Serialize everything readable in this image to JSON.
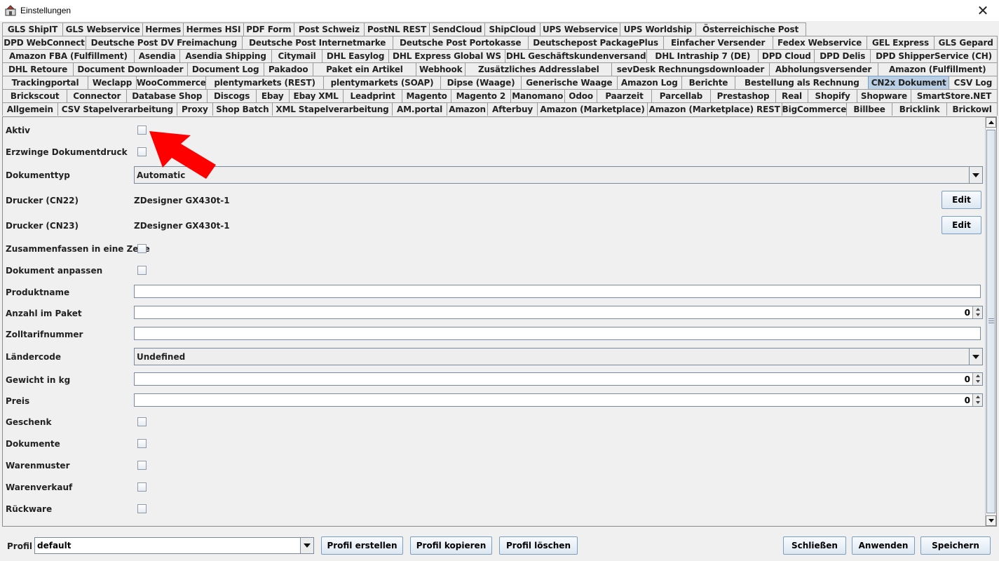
{
  "window": {
    "title": "Einstellungen",
    "close_glyph": "✕"
  },
  "tabs": {
    "rows": [
      [
        "GLS ShipIT",
        "GLS Webservice",
        "Hermes",
        "Hermes HSI",
        "PDF Form",
        "Post Schweiz",
        "PostNL REST",
        "SendCloud",
        "ShipCloud",
        "UPS Webservice",
        "UPS Worldship",
        "Österreichische Post"
      ],
      [
        "DPD WebConnect",
        "Deutsche Post DV Freimachung",
        "Deutsche Post Internetmarke",
        "Deutsche Post Portokasse",
        "Deutschepost PackagePlus",
        "Einfacher Versender",
        "Fedex Webservice",
        "GEL Express",
        "GLS Gepard"
      ],
      [
        "Amazon FBA (Fulfillment)",
        "Asendia",
        "Asendia Shipping",
        "Citymail",
        "DHL Easylog",
        "DHL Express Global WS",
        "DHL Geschäftskundenversand",
        "DHL Intraship 7 (DE)",
        "DPD Cloud",
        "DPD Delis",
        "DPD ShipperService (CH)"
      ],
      [
        "DHL Retoure",
        "Document Downloader",
        "Document Log",
        "Pakadoo",
        "Paket ein Artikel",
        "Webhook",
        "Zusätzliches Addresslabel",
        "sevDesk Rechnungsdownloader",
        "Abholungsversender",
        "Amazon (Fulfillment)"
      ],
      [
        "Trackingportal",
        "Weclapp",
        "WooCommerce",
        "plentymarkets (REST)",
        "plentymarkets (SOAP)",
        "Dipse (Waage)",
        "Generische Waage",
        "Amazon Log",
        "Berichte",
        "Bestellung als Rechnung",
        "CN2x Dokument",
        "CSV Log"
      ],
      [
        "Brickscout",
        "Connector",
        "Database Shop",
        "Discogs",
        "Ebay",
        "Ebay XML",
        "Leadprint",
        "Magento",
        "Magento 2",
        "Manomano",
        "Odoo",
        "Paarzeit",
        "Parcellab",
        "Prestashop",
        "Real",
        "Shopify",
        "Shopware",
        "SmartStore.NET"
      ],
      [
        "Allgemein",
        "CSV Stapelverarbeitung",
        "Proxy",
        "Shop Batch",
        "XML Stapelverarbeitung",
        "AM.portal",
        "Amazon",
        "Afterbuy",
        "Amazon (Marketplace)",
        "Amazon (Marketplace) REST",
        "BigCommerce",
        "Billbee",
        "Bricklink",
        "Brickowl"
      ]
    ],
    "active": "CN2x Dokument"
  },
  "form": {
    "aktiv": {
      "label": "Aktiv",
      "checked": false
    },
    "erzwinge": {
      "label": "Erzwinge Dokumentdruck",
      "checked": false
    },
    "dokumenttyp": {
      "label": "Dokumenttyp",
      "value": "Automatic"
    },
    "drucker_cn22": {
      "label": "Drucker (CN22)",
      "value": "ZDesigner GX430t-1",
      "button": "Edit"
    },
    "drucker_cn23": {
      "label": "Drucker (CN23)",
      "value": "ZDesigner GX430t-1",
      "button": "Edit"
    },
    "zusammenfassen": {
      "label": "Zusammenfassen in eine Zeile",
      "checked": false
    },
    "dokument_anpassen": {
      "label": "Dokument anpassen",
      "checked": false
    },
    "produktname": {
      "label": "Produktname",
      "value": ""
    },
    "anzahl": {
      "label": "Anzahl im Paket",
      "value": "0"
    },
    "zolltarif": {
      "label": "Zolltarifnummer",
      "value": ""
    },
    "laendercode": {
      "label": "Ländercode",
      "value": "Undefined"
    },
    "gewicht": {
      "label": "Gewicht in kg",
      "value": "0"
    },
    "preis": {
      "label": "Preis",
      "value": "0"
    },
    "geschenk": {
      "label": "Geschenk",
      "checked": false
    },
    "dokumente": {
      "label": "Dokumente",
      "checked": false
    },
    "warenmuster": {
      "label": "Warenmuster",
      "checked": false
    },
    "warenverkauf": {
      "label": "Warenverkauf",
      "checked": false
    },
    "rueckware": {
      "label": "Rückware",
      "checked": false
    }
  },
  "bottom": {
    "profil_label": "Profil",
    "profil_value": "default",
    "profil_erstellen": "Profil erstellen",
    "profil_kopieren": "Profil kopieren",
    "profil_loeschen": "Profil löschen",
    "schliessen": "Schließen",
    "anwenden": "Anwenden",
    "speichern": "Speichern"
  },
  "colors": {
    "active_tab": "#b8cfe5",
    "arrow": "#ff0000",
    "background": "#f0f0f0"
  }
}
